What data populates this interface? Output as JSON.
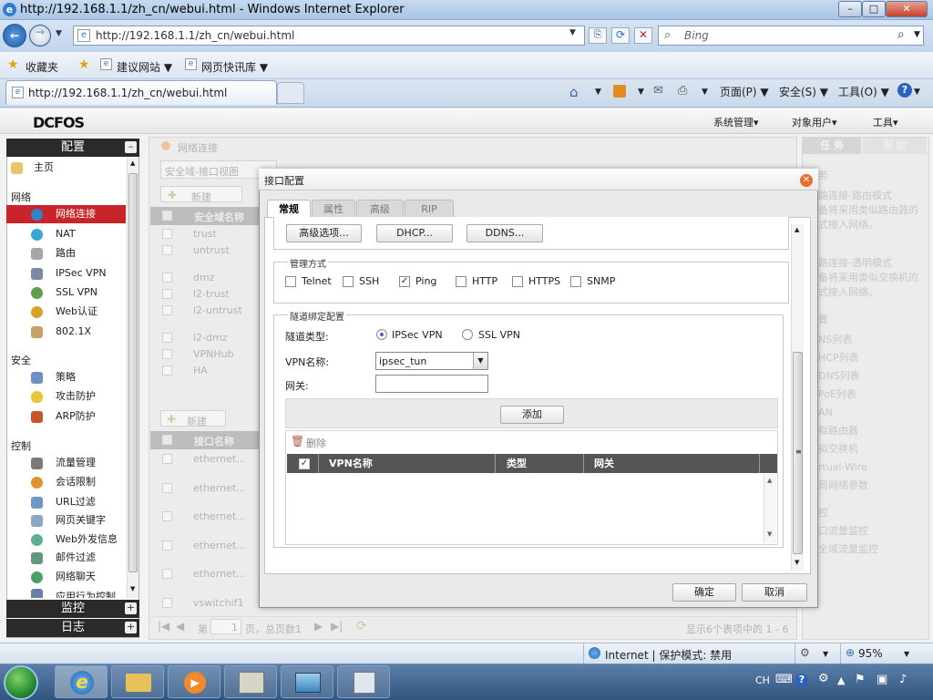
{
  "browser": {
    "title": "http://192.168.1.1/zh_cn/webui.html - Windows Internet Explorer",
    "address": "http://192.168.1.1/zh_cn/webui.html",
    "search_placeholder": "Bing",
    "favorites": "收藏夹",
    "fav_links": [
      "建议网站 ▼",
      "网页快讯库 ▼"
    ],
    "tab_title": "http://192.168.1.1/zh_cn/webui.html",
    "commands": [
      "页面(P) ▼",
      "安全(S) ▼",
      "工具(O) ▼"
    ],
    "status_zone": "Internet | 保护模式: 禁用",
    "zoom": "95%"
  },
  "app": {
    "logo": "DCFOS",
    "top_menu": [
      "系统管理▾",
      "对象用户▾",
      "工具▾"
    ],
    "sidebar": {
      "header": "配置",
      "home": "主页",
      "sections": [
        {
          "title": "网络",
          "items": [
            "网络连接",
            "NAT",
            "路由",
            "IPSec VPN",
            "SSL VPN",
            "Web认证",
            "802.1X"
          ]
        },
        {
          "title": "安全",
          "items": [
            "策略",
            "攻击防护",
            "ARP防护"
          ]
        },
        {
          "title": "控制",
          "items": [
            "流量管理",
            "会话限制",
            "URL过滤",
            "网页关键字",
            "Web外发信息",
            "邮件过滤",
            "网络聊天",
            "应用行为控制"
          ]
        }
      ],
      "footer1": "监控",
      "footer2": "日志",
      "selected": "网络连接"
    },
    "main": {
      "title": "网络连接",
      "view_select": "安全域-接口视图",
      "new_btn": "新建",
      "zone_header": "安全域名称",
      "zones": [
        "trust",
        "untrust",
        "dmz",
        "l2-trust",
        "l2-untrust",
        "l2-dmz",
        "VPNHub",
        "HA"
      ],
      "new_btn2": "新建",
      "if_header": "接口名称",
      "ifaces": [
        "ethernet...",
        "ethernet...",
        "ethernet...",
        "ethernet...",
        "ethernet...",
        "vswitchif1"
      ],
      "pager_page": "第",
      "pager_page_val": "1",
      "pager_total": "页，总页数1",
      "pager_info": "显示6个表项中的 1 - 6"
    },
    "right_panel": {
      "tabs": [
        "任 务",
        "帮 助"
      ],
      "lines": [
        "务",
        "路连接-路由模式",
        "备将采用类似路由器的",
        "式接入网络。",
        "路连接-透明模式",
        "备将采用类似交换机的",
        "式接入网络。",
        "置",
        "NS列表",
        "HCP列表",
        "DNS列表",
        "PoE列表",
        "AN",
        "拟路由器",
        "拟交换机",
        "rtual-Wire",
        "局网络参数",
        "控",
        "口流量监控",
        "全域流量监控"
      ]
    },
    "dialog": {
      "title": "接口配置",
      "tabs": [
        "常规",
        "属性",
        "高级",
        "RIP"
      ],
      "top_buttons": [
        "高级选项...",
        "DHCP...",
        "DDNS..."
      ],
      "mgmt": {
        "legend": "管理方式",
        "options": [
          {
            "label": "Telnet",
            "checked": false
          },
          {
            "label": "SSH",
            "checked": false
          },
          {
            "label": "Ping",
            "checked": true
          },
          {
            "label": "HTTP",
            "checked": false
          },
          {
            "label": "HTTPS",
            "checked": false
          },
          {
            "label": "SNMP",
            "checked": false
          }
        ]
      },
      "tunnel": {
        "legend": "隧道绑定配置",
        "type_label": "隧道类型:",
        "type_options": [
          "IPSec VPN",
          "SSL VPN"
        ],
        "type_selected": "IPSec VPN",
        "vpn_label": "VPN名称:",
        "vpn_value": "ipsec_tun",
        "gw_label": "网关:",
        "gw_value": "",
        "add_btn": "添加",
        "delete_btn": "删除",
        "columns": [
          "VPN名称",
          "类型",
          "网关"
        ]
      },
      "ok": "确定",
      "cancel": "取消"
    }
  },
  "taskbar": {
    "lang": "CH"
  }
}
